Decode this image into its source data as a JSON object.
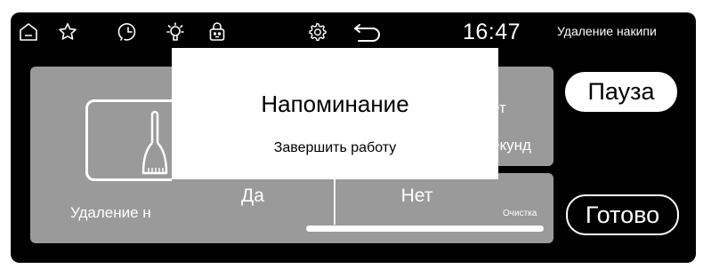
{
  "status_bar": {
    "icons": [
      "home-icon",
      "star-icon",
      "clock-icon",
      "light-icon",
      "lock-icon",
      "settings-icon",
      "back-icon"
    ],
    "time": "16:47",
    "mode_title": "Удаление накипи"
  },
  "program": {
    "name_partial": "Удаление н",
    "icon": "brush-icon"
  },
  "timer": {
    "line1_partial": "ет",
    "line2_partial": "екунд"
  },
  "stage": {
    "label": "Очистка",
    "progress": 1.0
  },
  "buttons": {
    "pause": "Пауза",
    "done": "Готово"
  },
  "dialog": {
    "title": "Напоминание",
    "message": "Завершить работу",
    "yes": "Да",
    "no": "Нет"
  },
  "colors": {
    "background": "#000000",
    "panel": "#9a9a9a",
    "dialog": "#ffffff",
    "text_light": "#ffffff"
  }
}
